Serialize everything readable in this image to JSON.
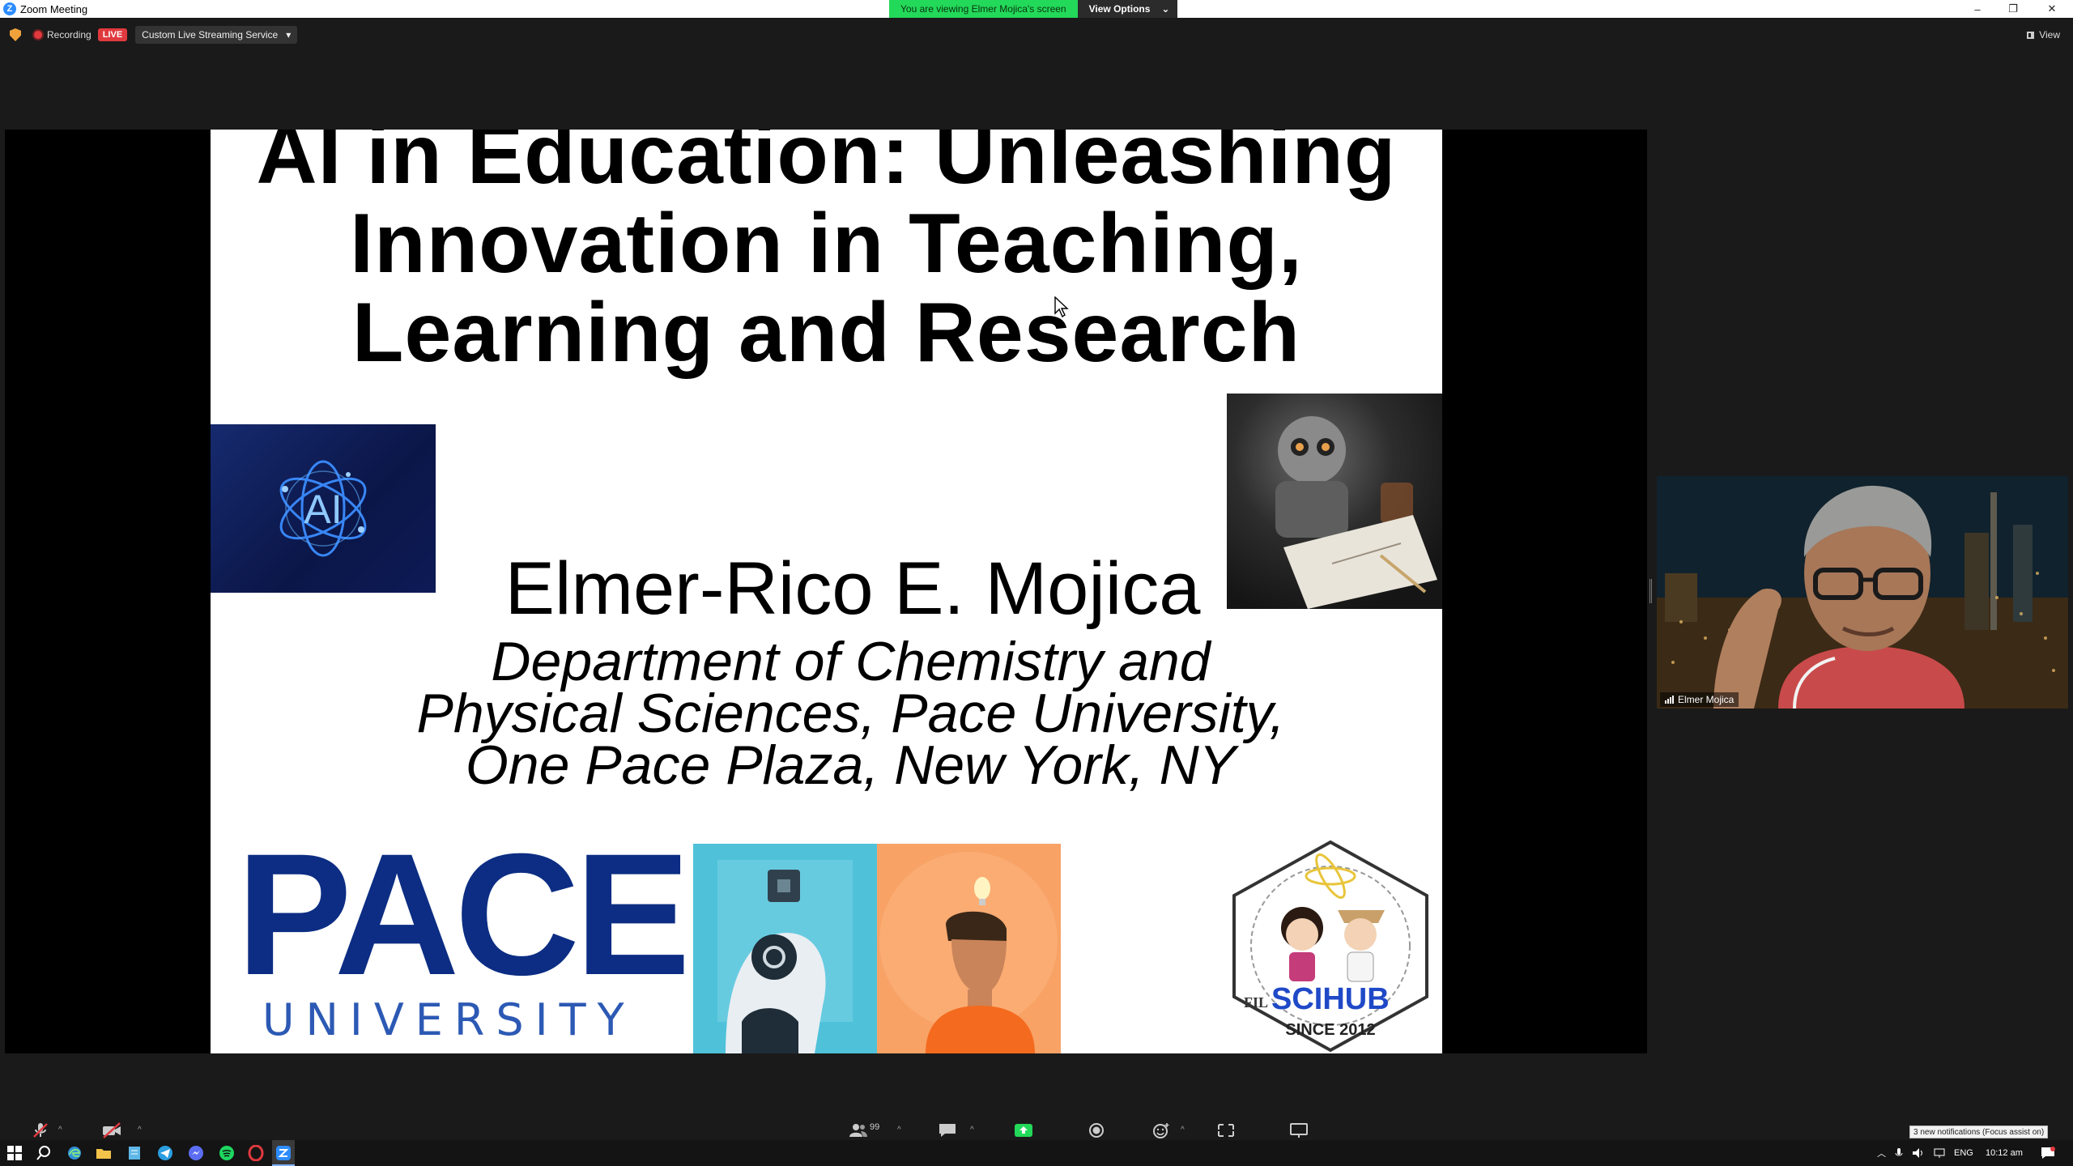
{
  "window": {
    "title": "Zoom Meeting",
    "logo_letter": "Z",
    "controls": [
      "–",
      "❐",
      "✕"
    ]
  },
  "banner": {
    "viewing_text": "You are viewing Elmer Mojica's screen",
    "view_options_label": "View Options",
    "caret": "⌄"
  },
  "status": {
    "recording_label": "Recording",
    "live_label": "LIVE",
    "stream_service": "Custom Live Streaming Service",
    "stream_caret": "▾",
    "view_label": "View"
  },
  "slide": {
    "title_line1": "AI in Education: Unleashing",
    "title_line2": "Innovation in Teaching,",
    "title_line3": "Learning and Research",
    "presenter": "Elmer-Rico E. Mojica",
    "dept_line1": "Department of Chemistry and",
    "dept_line2": "Physical Sciences, Pace University,",
    "dept_line3": "One Pace Plaza, New York, NY",
    "ai_logo_text": "AI",
    "pace_text": "PACE",
    "university_text": "UNIVERSITY",
    "scihub_prefix": "FIL",
    "scihub_text": "SCIHUB",
    "scihub_since": "SINCE 2012"
  },
  "participant": {
    "name": "Elmer Mojica"
  },
  "toolbar": {
    "participant_count": "99",
    "caret": "^"
  },
  "notification": {
    "text": "3 new notifications (Focus assist on)"
  },
  "tray": {
    "language": "ENG",
    "time": "10:12 am"
  },
  "colors": {
    "zoom_green": "#23d959",
    "live_red": "#e0393e",
    "pace_blue": "#0c2d83",
    "zoom_blue": "#2d8cff"
  }
}
